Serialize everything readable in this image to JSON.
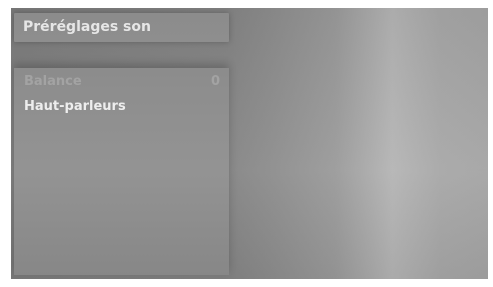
{
  "header": {
    "title": "Préréglages son"
  },
  "menu": {
    "items": [
      {
        "label": "Balance",
        "value": "0"
      },
      {
        "label": "Haut-parleurs",
        "value": ""
      }
    ]
  },
  "colors": {
    "panel": "#8f8f8f",
    "title_bar": "#939393",
    "text_active": "#f2f2f2",
    "text_dim": "#a6a6a6"
  }
}
